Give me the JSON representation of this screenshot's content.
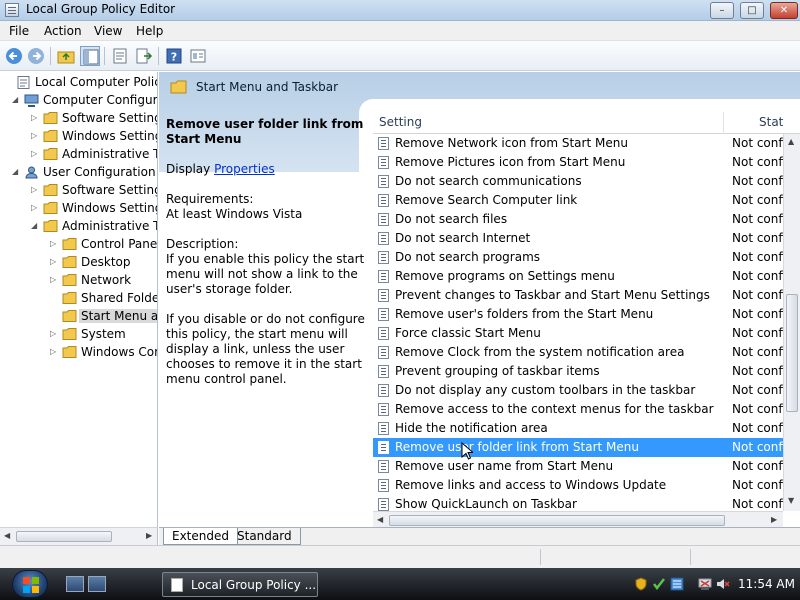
{
  "window": {
    "title": "Local Group Policy Editor"
  },
  "menu": [
    "File",
    "Action",
    "View",
    "Help"
  ],
  "tree": {
    "items": [
      {
        "label": "Local Computer Policy",
        "depth": 0,
        "arrow": "",
        "icon": "computer-policy",
        "selected": false
      },
      {
        "label": "Computer Configura",
        "depth": 1,
        "arrow": "◢",
        "icon": "computer",
        "selected": false
      },
      {
        "label": "Software Settings",
        "depth": 2,
        "arrow": "▷",
        "icon": "folder",
        "selected": false
      },
      {
        "label": "Windows Setting",
        "depth": 2,
        "arrow": "▷",
        "icon": "folder",
        "selected": false
      },
      {
        "label": "Administrative Te",
        "depth": 2,
        "arrow": "▷",
        "icon": "folder",
        "selected": false
      },
      {
        "label": "User Configuration",
        "depth": 1,
        "arrow": "◢",
        "icon": "user",
        "selected": false
      },
      {
        "label": "Software Settings",
        "depth": 2,
        "arrow": "▷",
        "icon": "folder",
        "selected": false
      },
      {
        "label": "Windows Setting",
        "depth": 2,
        "arrow": "▷",
        "icon": "folder",
        "selected": false
      },
      {
        "label": "Administrative Te",
        "depth": 2,
        "arrow": "◢",
        "icon": "folder",
        "selected": false
      },
      {
        "label": "Control Panel",
        "depth": 3,
        "arrow": "▷",
        "icon": "folder",
        "selected": false
      },
      {
        "label": "Desktop",
        "depth": 3,
        "arrow": "▷",
        "icon": "folder",
        "selected": false
      },
      {
        "label": "Network",
        "depth": 3,
        "arrow": "▷",
        "icon": "folder",
        "selected": false
      },
      {
        "label": "Shared Folder",
        "depth": 3,
        "arrow": "",
        "icon": "folder",
        "selected": false
      },
      {
        "label": "Start Menu ar",
        "depth": 3,
        "arrow": "",
        "icon": "folder",
        "selected": true
      },
      {
        "label": "System",
        "depth": 3,
        "arrow": "▷",
        "icon": "folder",
        "selected": false
      },
      {
        "label": "Windows Cor",
        "depth": 3,
        "arrow": "▷",
        "icon": "folder",
        "selected": false
      }
    ]
  },
  "header": {
    "title": "Start Menu and Taskbar"
  },
  "description": {
    "title": "Remove user folder link from Start Menu",
    "display_prefix": "Display",
    "properties_link": "Properties",
    "requirements_label": "Requirements:",
    "requirements_value": "At least Windows Vista",
    "description_label": "Description:",
    "paragraph1": "If you enable this policy the start menu will not show a link to the user's storage folder.",
    "paragraph2": "If you disable or do not configure this policy, the start menu will display a link, unless the user chooses to remove it in the start menu control panel."
  },
  "list": {
    "columns": {
      "setting": "Setting",
      "state": "Stat"
    },
    "rows": [
      {
        "name": "Remove Network icon from Start Menu",
        "state": "Not confi",
        "selected": false
      },
      {
        "name": "Remove Pictures icon from Start Menu",
        "state": "Not confi",
        "selected": false
      },
      {
        "name": "Do not search communications",
        "state": "Not confi",
        "selected": false
      },
      {
        "name": "Remove Search Computer link",
        "state": "Not confi",
        "selected": false
      },
      {
        "name": "Do not search files",
        "state": "Not confi",
        "selected": false
      },
      {
        "name": "Do not search Internet",
        "state": "Not confi",
        "selected": false
      },
      {
        "name": "Do not search programs",
        "state": "Not confi",
        "selected": false
      },
      {
        "name": "Remove programs on Settings menu",
        "state": "Not confi",
        "selected": false
      },
      {
        "name": "Prevent changes to Taskbar and Start Menu Settings",
        "state": "Not confi",
        "selected": false
      },
      {
        "name": "Remove user's folders from the Start Menu",
        "state": "Not confi",
        "selected": false
      },
      {
        "name": "Force classic Start Menu",
        "state": "Not confi",
        "selected": false
      },
      {
        "name": "Remove Clock from the system notification area",
        "state": "Not confi",
        "selected": false
      },
      {
        "name": "Prevent grouping of taskbar items",
        "state": "Not confi",
        "selected": false
      },
      {
        "name": "Do not display any custom toolbars in the taskbar",
        "state": "Not confi",
        "selected": false
      },
      {
        "name": "Remove access to the context menus for the taskbar",
        "state": "Not confi",
        "selected": false
      },
      {
        "name": "Hide the notification area",
        "state": "Not confi",
        "selected": false
      },
      {
        "name": "Remove user folder link from Start Menu",
        "state": "Not confi",
        "selected": true
      },
      {
        "name": "Remove user name from Start Menu",
        "state": "Not confi",
        "selected": false
      },
      {
        "name": "Remove links and access to Windows Update",
        "state": "Not confi",
        "selected": false
      },
      {
        "name": "Show QuickLaunch on Taskbar",
        "state": "Not confi",
        "selected": false
      }
    ]
  },
  "tabs": [
    "Extended",
    "Standard"
  ],
  "taskbar": {
    "task_label": "Local Group Policy ...",
    "clock": "11:54 AM"
  },
  "colors": {
    "selection": "#3399ff",
    "header_band": "#b7cfe6",
    "folder": "#f2c94c",
    "link": "#0033cc"
  }
}
